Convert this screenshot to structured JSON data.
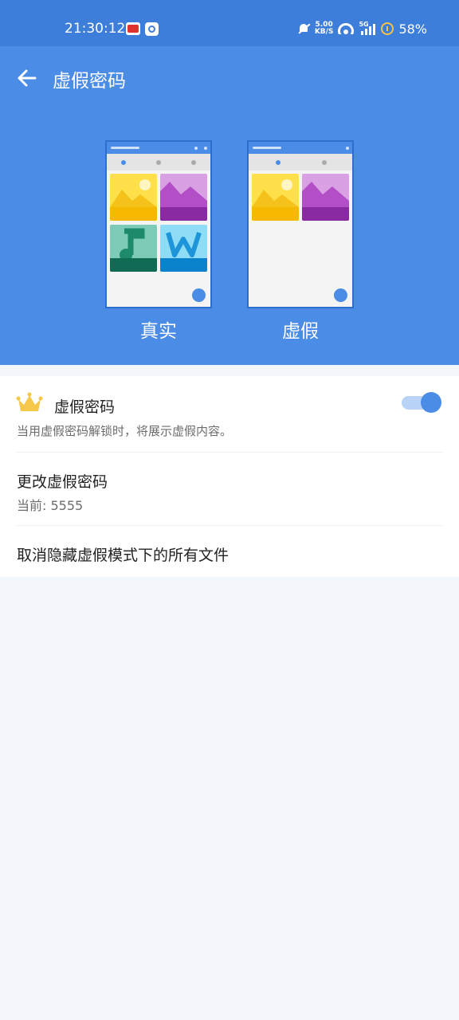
{
  "status_bar": {
    "time": "21:30:12",
    "app_badge_text": "头条",
    "net_speed_value": "5.00",
    "net_speed_unit": "KB/S",
    "network_type": "5G",
    "battery_percent": "58%"
  },
  "header": {
    "title": "虚假密码",
    "illustrations": [
      {
        "label": "真实"
      },
      {
        "label": "虚假"
      }
    ]
  },
  "settings": {
    "fake_password": {
      "title": "虚假密码",
      "description": "当用虚假密码解锁时，将展示虚假内容。",
      "enabled": true
    },
    "change_password": {
      "title": "更改虚假密码",
      "current": "当前: 5555"
    },
    "unhide_files": {
      "title": "取消隐藏虚假模式下的所有文件"
    }
  },
  "colors": {
    "primary": "#4a8ce6",
    "status_bar": "#3d7edb",
    "background": "#f3f6fa",
    "crown": "#f6c84a"
  }
}
